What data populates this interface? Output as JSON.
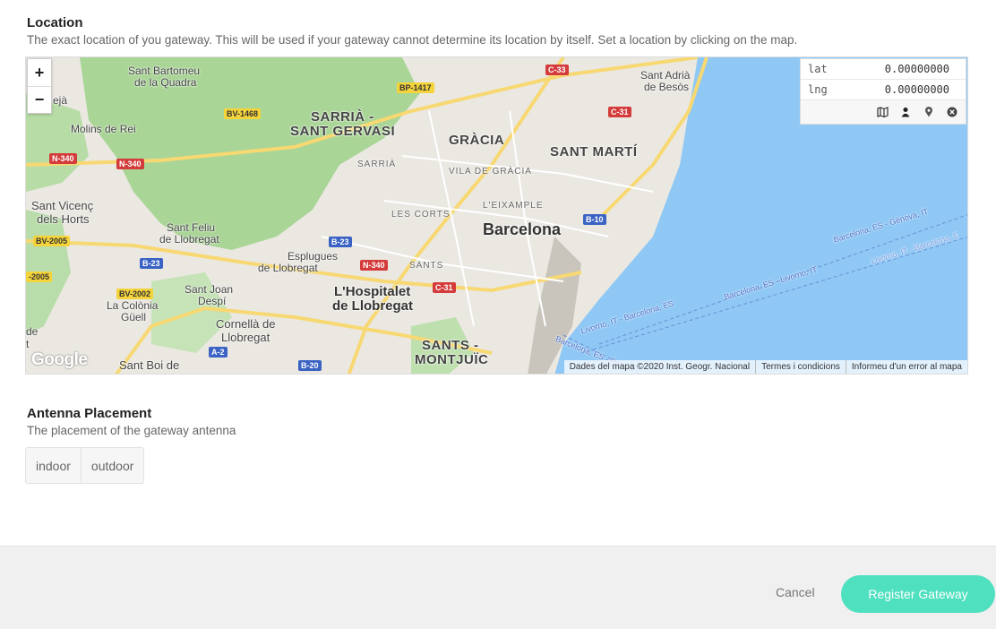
{
  "location": {
    "title": "Location",
    "description": "The exact location of you gateway. This will be used if your gateway cannot determine its location by itself. Set a location by clicking on the map."
  },
  "map": {
    "zoom_in": "+",
    "zoom_out": "−",
    "lat_label": "lat",
    "lat_value": "0.00000000",
    "lng_label": "lng",
    "lng_value": "0.00000000",
    "tools": [
      "map-icon",
      "person-icon",
      "pin-icon",
      "clear-icon"
    ],
    "google": "Google",
    "attribution": [
      "Dades del mapa ©2020 Inst. Geogr. Nacional",
      "Termes i condicions",
      "Informeu d'un error al mapa"
    ],
    "labels": {
      "barcelona": "Barcelona",
      "sant_marti": "SANT MARTÍ",
      "gracia": "GRÀCIA",
      "sarria_sg_1": "SARRIÀ -",
      "sarria_sg_2": "SANT GERVASI",
      "sarria": "SARRIÀ",
      "vila_gracia": "VILA DE GRÀCIA",
      "eixample": "L'EIXAMPLE",
      "les_corts": "LES CORTS",
      "sants": "SANTS",
      "sants_mont_1": "SANTS -",
      "sants_mont_2": "MONTJUÏC",
      "hospitalet_1": "L'Hospitalet",
      "hospitalet_2": "de Llobregat",
      "esplugues_1": "Esplugues",
      "esplugues_2": "de Llobregat",
      "sant_feliu_1": "Sant Feliu",
      "sant_feliu_2": "de Llobregat",
      "sant_joan_1": "Sant Joan",
      "sant_joan_2": "Despí",
      "cornella_1": "Cornellà de",
      "cornella_2": "Llobregat",
      "colonia_1": "La Colònia",
      "colonia_2": "Güell",
      "sant_boi": "Sant Boi de",
      "sant_vicenc_1": "Sant Vicenç",
      "sant_vicenc_2": "dels Horts",
      "molins": "Molins de Rei",
      "sant_bartomeu_1": "Sant Bartomeu",
      "sant_bartomeu_2": "de la Quadra",
      "sant_adria_1": "Sant Adrià",
      "sant_adria_2": "de Besòs",
      "eja": "ejà",
      "de": "de",
      "t": "t",
      "ferry_1": "Barcelona, ES - Génova, IT",
      "ferry_2": "Livorno, IT - Barcelona, E",
      "ferry_3": "Barcelona, ES - Livorno, IT",
      "ferry_4": "Livorno, IT - Barcelona, ES",
      "ferry_5": "Barcelona, ES - Po"
    },
    "roads": {
      "c33": "C-33",
      "c31a": "C-31",
      "c31b": "C-31",
      "bp1417": "BP-1417",
      "bv1468": "BV-1468",
      "n340a": "N-340",
      "n340b": "N-340",
      "n340c": "N-340",
      "b10": "B-10",
      "b23a": "B-23",
      "b23b": "B-23",
      "bv2005a": "BV-2005",
      "bv2005b": "-2005",
      "bv2002": "BV-2002",
      "a2": "A-2",
      "b20": "B-20"
    }
  },
  "antenna": {
    "title": "Antenna Placement",
    "description": "The placement of the gateway antenna",
    "options": [
      "indoor",
      "outdoor"
    ]
  },
  "footer": {
    "cancel": "Cancel",
    "register": "Register Gateway"
  },
  "colors": {
    "accent": "#4fe0bf",
    "sea": "#8fc8f5",
    "park": "#a9d596",
    "land": "#ebe8e2"
  }
}
